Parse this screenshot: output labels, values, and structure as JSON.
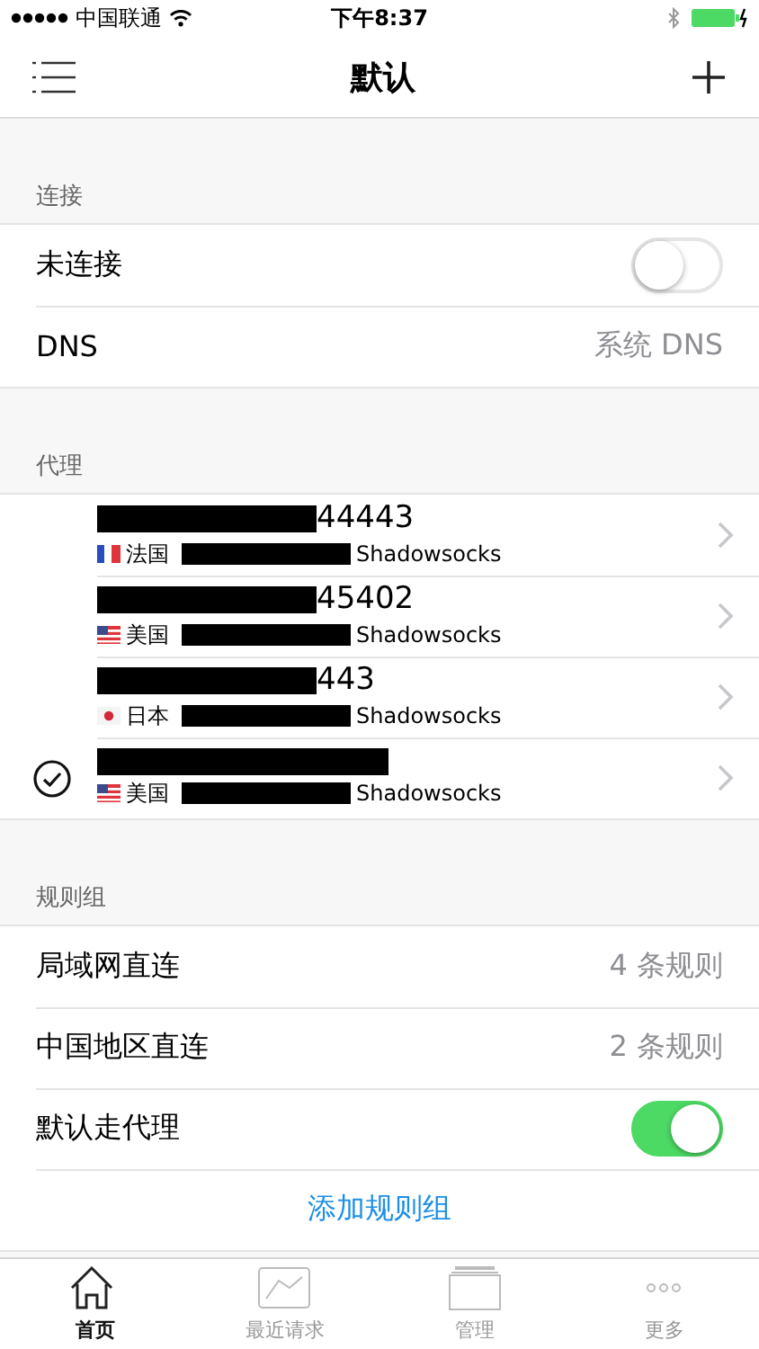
{
  "status_bar": {
    "carrier": "中国联通",
    "time": "下午8:37"
  },
  "nav": {
    "title": "默认"
  },
  "sections": [
    {
      "header": "连接",
      "rows": [
        {
          "kind": "toggle",
          "label": "未连接",
          "on": false
        },
        {
          "kind": "value",
          "label": "DNS",
          "value": "系统 DNS"
        }
      ]
    },
    {
      "header": "代理",
      "rows": [
        {
          "kind": "proxy",
          "name": "44443",
          "flag": {
            "kind": "fr"
          },
          "region": "法国",
          "type": "Shadowsocks",
          "selected": false
        },
        {
          "kind": "proxy",
          "name": "45402",
          "flag": {
            "kind": "us"
          },
          "region": "美国",
          "type": "Shadowsocks",
          "selected": false
        },
        {
          "kind": "proxy",
          "name": "443",
          "flag": {
            "kind": "jp"
          },
          "region": "日本",
          "type": "Shadowsocks",
          "selected": false
        },
        {
          "kind": "proxy",
          "flag": {
            "kind": "us"
          },
          "region": "美国",
          "type": "Shadowsocks",
          "selected": true
        }
      ]
    },
    {
      "header": "规则组",
      "rows": [
        {
          "kind": "value",
          "label": "局域网直连",
          "value": "4 条规则"
        },
        {
          "kind": "value",
          "label": "中国地区直连",
          "value": "2 条规则"
        },
        {
          "kind": "toggle",
          "label": "默认走代理",
          "on": true
        },
        {
          "kind": "action",
          "label": "添加规则组"
        }
      ]
    }
  ],
  "tabs": [
    {
      "kind": "home",
      "label": "首页",
      "selected": true
    },
    {
      "kind": "chart",
      "label": "最近请求",
      "selected": false
    },
    {
      "kind": "stack",
      "label": "管理",
      "selected": false
    },
    {
      "kind": "more",
      "label": "更多",
      "selected": false
    }
  ]
}
